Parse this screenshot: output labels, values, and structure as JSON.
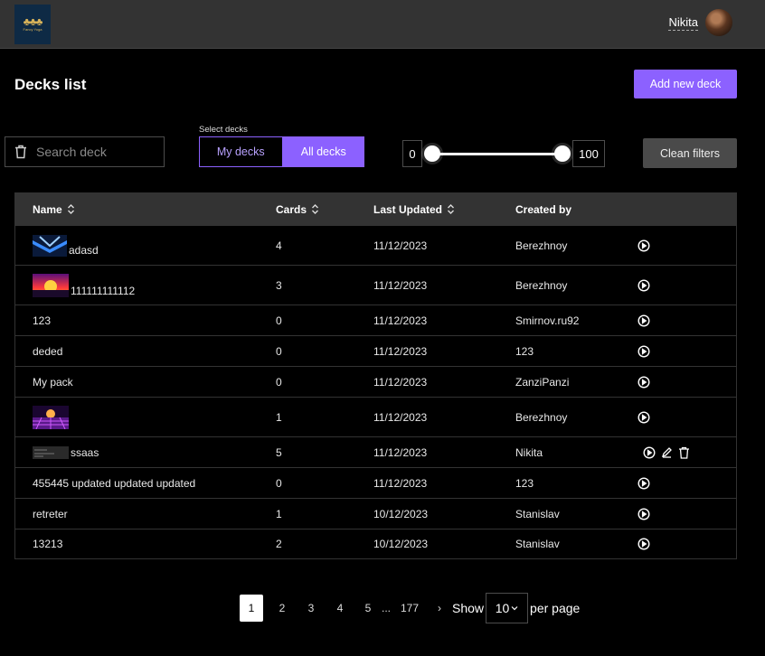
{
  "header": {
    "logo_text": "Fancy Yoga",
    "user_name": "Nikita"
  },
  "page": {
    "title": "Decks list",
    "add_button": "Add new deck"
  },
  "filters": {
    "search_placeholder": "Search deck",
    "select_label": "Select decks",
    "tabs": [
      {
        "label": "My decks",
        "active": false
      },
      {
        "label": "All decks",
        "active": true
      }
    ],
    "range_min": "0",
    "range_max": "100",
    "clean_button": "Clean filters"
  },
  "table": {
    "columns": [
      "Name",
      "Cards",
      "Last Updated",
      "Created by"
    ],
    "rows": [
      {
        "name": "adasd",
        "cards": "4",
        "updated": "11/12/2023",
        "created_by": "Berezhnoy",
        "image": "blue-wave"
      },
      {
        "name": "111111111112",
        "cards": "3",
        "updated": "11/12/2023",
        "created_by": "Berezhnoy",
        "image": "sunset"
      },
      {
        "name": "123",
        "cards": "0",
        "updated": "11/12/2023",
        "created_by": "Smirnov.ru92",
        "image": ""
      },
      {
        "name": "deded",
        "cards": "0",
        "updated": "11/12/2023",
        "created_by": "123",
        "image": ""
      },
      {
        "name": "My pack",
        "cards": "0",
        "updated": "11/12/2023",
        "created_by": "ZanziPanzi",
        "image": ""
      },
      {
        "name": "",
        "cards": "1",
        "updated": "11/12/2023",
        "created_by": "Berezhnoy",
        "image": "retro-grid"
      },
      {
        "name": "ssaas",
        "cards": "5",
        "updated": "11/12/2023",
        "created_by": "Nikita",
        "image": "code-screenshot"
      },
      {
        "name": "455445 updated updated updated",
        "cards": "0",
        "updated": "11/12/2023",
        "created_by": "123",
        "image": ""
      },
      {
        "name": "retreter",
        "cards": "1",
        "updated": "10/12/2023",
        "created_by": "Stanislav",
        "image": ""
      },
      {
        "name": "13213",
        "cards": "2",
        "updated": "10/12/2023",
        "created_by": "Stanislav",
        "image": ""
      }
    ]
  },
  "pagination": {
    "pages": [
      "1",
      "2",
      "3",
      "4",
      "5"
    ],
    "ellipsis": "...",
    "last_page": "177",
    "next": "›",
    "show_label": "Show",
    "per_page_value": "10",
    "per_page_label": "per page"
  },
  "colors": {
    "accent": "#8c61ff",
    "header_bg": "#333333",
    "table_head_bg": "#333333",
    "secondary_button": "#4a4a4a"
  }
}
